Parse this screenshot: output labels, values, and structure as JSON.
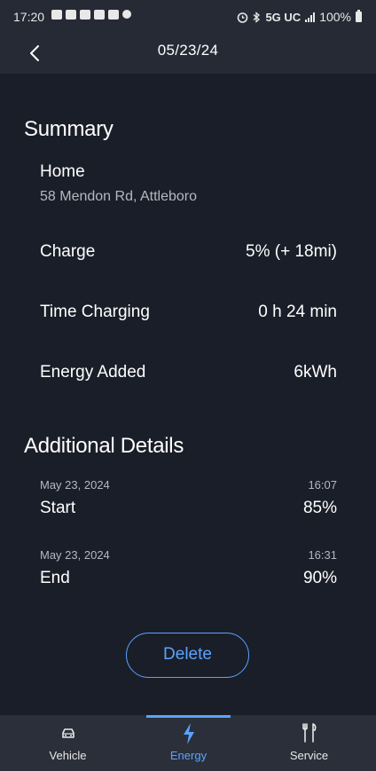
{
  "status_bar": {
    "time": "17:20",
    "network": "5G UC",
    "battery": "100%"
  },
  "header": {
    "title": "05/23/24",
    "back_icon": "chevron-left-icon"
  },
  "summary": {
    "title": "Summary",
    "location_name": "Home",
    "location_address": "58 Mendon Rd, Attleboro",
    "rows": [
      {
        "label": "Charge",
        "value": "5% (+ 18mi)"
      },
      {
        "label": "Time Charging",
        "value": "0 h 24 min"
      },
      {
        "label": "Energy Added",
        "value": "6kWh"
      }
    ]
  },
  "additional": {
    "title": "Additional Details",
    "entries": [
      {
        "date": "May 23, 2024",
        "time": "16:07",
        "label": "Start",
        "value": "85%"
      },
      {
        "date": "May 23, 2024",
        "time": "16:31",
        "label": "End",
        "value": "90%"
      }
    ]
  },
  "delete_label": "Delete",
  "bottom_nav": {
    "items": [
      {
        "label": "Vehicle",
        "icon": "car-icon"
      },
      {
        "label": "Energy",
        "icon": "lightning-bolt-icon",
        "active": true
      },
      {
        "label": "Service",
        "icon": "tools-icon"
      }
    ]
  },
  "colors": {
    "background": "#1a1e28",
    "header": "#262a35",
    "nav_bar": "#2b2f3a",
    "accent": "#5aa3ff",
    "secondary_text": "#b4b8c0"
  }
}
